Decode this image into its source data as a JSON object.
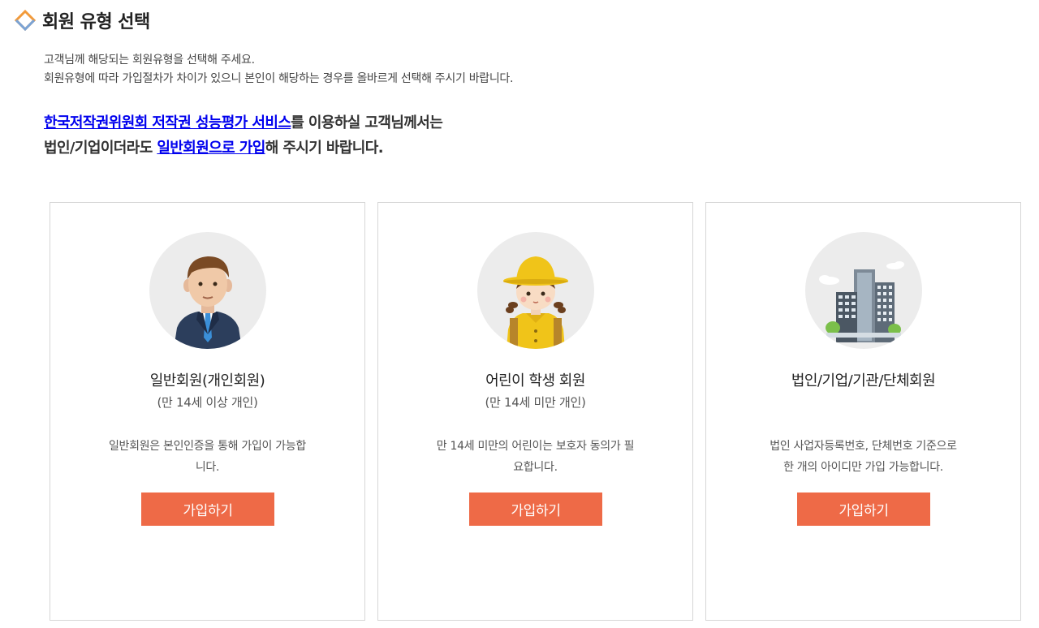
{
  "header": {
    "title": "회원 유형 선택",
    "icon": "diamond-outline-icon",
    "icon_colors": [
      "#f29a3a",
      "#7aa3d6"
    ]
  },
  "intro": {
    "line1": "고객님께 해당되는 회원유형을 선택해 주세요.",
    "line2": "회원유형에 따라 가입절차가 차이가 있으니 본인이 해당하는 경우를 올바르게 선택해 주시기 바랍니다."
  },
  "notice": {
    "link1": "한국저작권위원회 저작권 성능평가 서비스",
    "text1": "를 이용하실 고객님께서는",
    "text2": "법인/기업이더라도 ",
    "link2": "일반회원으로 가입",
    "text3": "해 주시기 바랍니다."
  },
  "cards": [
    {
      "icon": "businessman-avatar-icon",
      "title": "일반회원(개인회원)",
      "subtitle": "(만 14세 이상 개인)",
      "desc_line1": "일반회원은 본인인증을 통해 가입이 가능합",
      "desc_line2": "니다.",
      "button": "가입하기"
    },
    {
      "icon": "child-student-avatar-icon",
      "title": "어린이 학생 회원",
      "subtitle": "(만 14세 미만 개인)",
      "desc_line1": "만 14세 미만의 어린이는 보호자 동의가 필",
      "desc_line2": "요합니다.",
      "button": "가입하기"
    },
    {
      "icon": "buildings-icon",
      "title": "법인/기업/기관/단체회원",
      "subtitle": "",
      "desc_line1": "법인 사업자등록번호, 단체번호 기준으로",
      "desc_line2": "한 개의 아이디만 가입 가능합니다.",
      "button": "가입하기"
    }
  ],
  "colors": {
    "button": "#ee6a47",
    "link": "#0000ee",
    "card_border": "#d6d6d6",
    "avatar_bg": "#ececec"
  }
}
